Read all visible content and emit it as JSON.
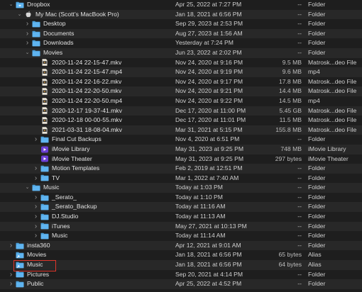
{
  "rows": [
    {
      "level": 1,
      "disc": "open",
      "icon": "dropbox",
      "name": "Dropbox",
      "date": "Apr 25, 2022 at 7:27 PM",
      "size": "--",
      "kind": "Folder"
    },
    {
      "level": 2,
      "disc": "open",
      "icon": "apple",
      "name": "My Mac (Scott’s MacBook Pro)",
      "date": "Jan 18, 2021 at 6:56 PM",
      "size": "--",
      "kind": "Folder"
    },
    {
      "level": 3,
      "disc": "closed",
      "icon": "folder",
      "name": "Desktop",
      "date": "Sep 29, 2023 at 2:53 PM",
      "size": "--",
      "kind": "Folder"
    },
    {
      "level": 3,
      "disc": "closed",
      "icon": "folder",
      "name": "Documents",
      "date": "Aug 27, 2023 at 1:56 AM",
      "size": "--",
      "kind": "Folder"
    },
    {
      "level": 3,
      "disc": "closed",
      "icon": "folder",
      "name": "Downloads",
      "date": "Yesterday at 7:24 PM",
      "size": "--",
      "kind": "Folder"
    },
    {
      "level": 3,
      "disc": "open",
      "icon": "folder",
      "name": "Movies",
      "date": "Jun 23, 2022 at 2:02 PM",
      "size": "--",
      "kind": "Folder"
    },
    {
      "level": 4,
      "disc": "none",
      "icon": "video",
      "name": "2020-11-24 22-15-47.mkv",
      "date": "Nov 24, 2020 at 9:16 PM",
      "size": "9.5 MB",
      "kind": "Matrosk...deo File"
    },
    {
      "level": 4,
      "disc": "none",
      "icon": "video",
      "name": "2020-11-24 22-15-47.mp4",
      "date": "Nov 24, 2020 at 9:19 PM",
      "size": "9.6 MB",
      "kind": "mp4"
    },
    {
      "level": 4,
      "disc": "none",
      "icon": "video",
      "name": "2020-11-24 22-16-22.mkv",
      "date": "Nov 24, 2020 at 9:17 PM",
      "size": "17.8 MB",
      "kind": "Matrosk...deo File"
    },
    {
      "level": 4,
      "disc": "none",
      "icon": "video",
      "name": "2020-11-24 22-20-50.mkv",
      "date": "Nov 24, 2020 at 9:21 PM",
      "size": "14.4 MB",
      "kind": "Matrosk...deo File"
    },
    {
      "level": 4,
      "disc": "none",
      "icon": "video",
      "name": "2020-11-24 22-20-50.mp4",
      "date": "Nov 24, 2020 at 9:22 PM",
      "size": "14.5 MB",
      "kind": "mp4"
    },
    {
      "level": 4,
      "disc": "none",
      "icon": "video",
      "name": "2020-12-17 19-37-41.mkv",
      "date": "Dec 17, 2020 at 11:00 PM",
      "size": "5.45 GB",
      "kind": "Matrosk...deo File"
    },
    {
      "level": 4,
      "disc": "none",
      "icon": "video",
      "name": "2020-12-18 00-00-55.mkv",
      "date": "Dec 17, 2020 at 11:01 PM",
      "size": "11.5 MB",
      "kind": "Matrosk...deo File"
    },
    {
      "level": 4,
      "disc": "none",
      "icon": "video",
      "name": "2021-03-31 18-08-04.mkv",
      "date": "Mar 31, 2021 at 5:15 PM",
      "size": "155.8 MB",
      "kind": "Matrosk...deo File"
    },
    {
      "level": 4,
      "disc": "closed",
      "icon": "folder",
      "name": "Final Cut Backups",
      "date": "Nov 4, 2020 at 6:51 PM",
      "size": "--",
      "kind": "Folder"
    },
    {
      "level": 4,
      "disc": "none",
      "icon": "imovie",
      "name": "iMovie Library",
      "date": "May 31, 2023 at 9:25 PM",
      "size": "748 MB",
      "kind": "iMovie Library"
    },
    {
      "level": 4,
      "disc": "none",
      "icon": "imovie",
      "name": "iMovie Theater",
      "date": "May 31, 2023 at 9:25 PM",
      "size": "297 bytes",
      "kind": "iMovie Theater"
    },
    {
      "level": 4,
      "disc": "closed",
      "icon": "folder",
      "name": "Motion Templates",
      "date": "Feb 2, 2019 at 12:51 PM",
      "size": "--",
      "kind": "Folder"
    },
    {
      "level": 4,
      "disc": "closed",
      "icon": "folder",
      "name": "TV",
      "date": "Mar 1, 2022 at 7:40 AM",
      "size": "--",
      "kind": "Folder"
    },
    {
      "level": 3,
      "disc": "open",
      "icon": "folder",
      "name": "Music",
      "date": "Today at 1:03 PM",
      "size": "--",
      "kind": "Folder"
    },
    {
      "level": 4,
      "disc": "closed",
      "icon": "folder",
      "name": "_Serato_",
      "date": "Today at 1:10 PM",
      "size": "--",
      "kind": "Folder"
    },
    {
      "level": 4,
      "disc": "closed",
      "icon": "folder",
      "name": "_Serato_Backup",
      "date": "Today at 11:16 AM",
      "size": "--",
      "kind": "Folder"
    },
    {
      "level": 4,
      "disc": "closed",
      "icon": "folder",
      "name": "DJ.Studio",
      "date": "Today at 11:13 AM",
      "size": "--",
      "kind": "Folder"
    },
    {
      "level": 4,
      "disc": "closed",
      "icon": "folder",
      "name": "iTunes",
      "date": "May 27, 2021 at 10:13 PM",
      "size": "--",
      "kind": "Folder"
    },
    {
      "level": 4,
      "disc": "closed",
      "icon": "folder",
      "name": "Music",
      "date": "Today at 11:14 AM",
      "size": "--",
      "kind": "Folder"
    },
    {
      "level": 1,
      "disc": "closed",
      "icon": "folder",
      "name": "insta360",
      "date": "Apr 12, 2021 at 9:01 AM",
      "size": "--",
      "kind": "Folder"
    },
    {
      "level": 1,
      "disc": "none",
      "icon": "alias",
      "name": "Movies",
      "date": "Jan 18, 2021 at 6:56 PM",
      "size": "65 bytes",
      "kind": "Alias"
    },
    {
      "level": 1,
      "disc": "none",
      "icon": "alias",
      "name": "Music",
      "date": "Jan 18, 2021 at 6:56 PM",
      "size": "64 bytes",
      "kind": "Alias"
    },
    {
      "level": 1,
      "disc": "closed",
      "icon": "folder",
      "name": "Pictures",
      "date": "Sep 20, 2021 at 4:14 PM",
      "size": "--",
      "kind": "Folder"
    },
    {
      "level": 1,
      "disc": "closed",
      "icon": "folder",
      "name": "Public",
      "date": "Apr 25, 2022 at 4:52 PM",
      "size": "--",
      "kind": "Folder"
    }
  ],
  "colors": {
    "folder": "#5fb4f0",
    "folder_tab": "#4a9ed8",
    "highlight_box": "#e0362b",
    "row_alt": "#282828",
    "background": "#1e1e1e"
  }
}
